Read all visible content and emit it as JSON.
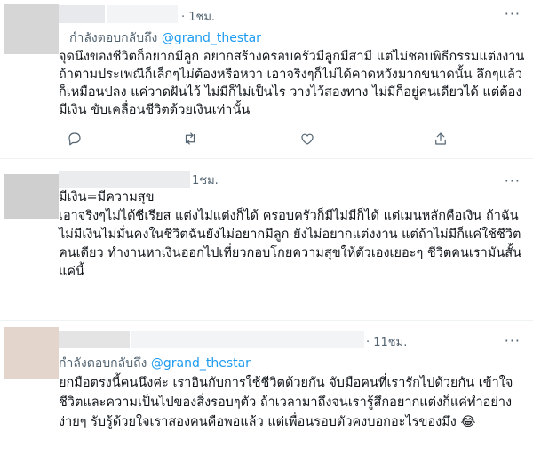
{
  "tweets": [
    {
      "time": "· 1ชม.",
      "reply_prefix": "กำลังตอบกลับถึง",
      "reply_handle": "@grand_thestar",
      "text": "จุดนึงของชีวิตก็อยากมีลูก อยากสร้างครอบครัวมีลูกมีสามี แต่ไม่ชอบพิธีกรรมแต่งงาน\nถ้าตามประเพณีก็เล็กๆไม่ต้องหรือหวา เอาจริงๆก็ไม่ได้คาดหวังมากขนาดนั้น ลึกๆแล้ว\nก็เหมือนปลง แค่วาดฝันไว้ ไม่มีก็ไม่เป็นไร วางไว้สองทาง ไม่มีก็อยู่คนเดียวได้ แต่ต้อง\nมีเงิน ขับเคลื่อนชีวิตด้วยเงินเท่านั้น",
      "avatar_color": "#d6d6d6"
    },
    {
      "time": "1ชม.",
      "text": "มีเงิน=มีความสุข\nเอาจริงๆไม่ได้ซีเรียส แต่งไม่แต่งก็ได้ ครอบครัวก็มีไม่มีก็ได้ แต่เมนหลักคือเงิน ถ้าฉัน\nไม่มีเงินไม่มั่นคงในชีวิตฉันยังไม่อยากมีลูก ยังไม่อยากแต่งงาน แต่ถ้าไม่มีก็แค่ใช้ชีวิต\nคนเดียว ทำงานหาเงินออกไปเที่ยวกอบโกยความสุขให้ตัวเองเยอะๆ ชีวิตคนเรามันสั้น\nแค่นี้",
      "avatar_color": "#cfcfcf"
    },
    {
      "time": "· 11ชม.",
      "reply_prefix": "กำลังตอบกลับถึง",
      "reply_handle": "@grand_thestar",
      "text": "ยกมือตรงนี้คนนึงค่ะ เราอินกับการใช้ชีวิตด้วยกัน จับมือคนที่เรารักไปด้วยกัน เข้าใจ\nชีวิตและความเป็นไปของสิ่งรอบๆตัว ถ้าเวลามาถึงจนเรารู้สึกอยากแต่งก็แค่ทำอย่าง\nง่ายๆ รับรู้ด้วยใจเราสองคนคือพอแล้ว แต่เพื่อนรอบตัวคงบอกอะไรของมึง 😂",
      "avatar_color": "#e3d5cc"
    }
  ],
  "more_glyph": "···",
  "icons": [
    "reply-icon",
    "retweet-icon",
    "like-icon",
    "share-icon"
  ]
}
